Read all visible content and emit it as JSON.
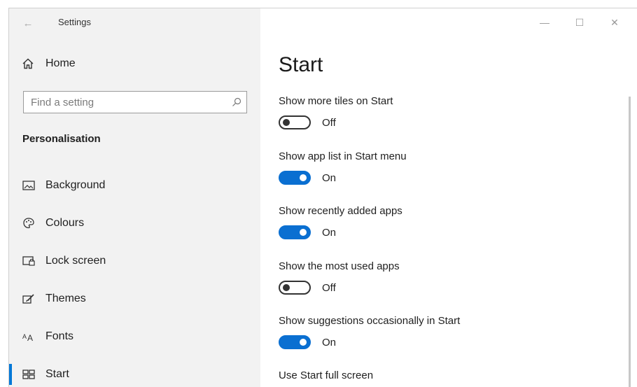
{
  "window": {
    "title": "Settings",
    "controls": {
      "minimize": "—",
      "maximize": "☐",
      "close": "✕"
    },
    "back_glyph": "←"
  },
  "sidebar": {
    "home_label": "Home",
    "search_placeholder": "Find a setting",
    "section_heading": "Personalisation",
    "items": [
      {
        "label": "Background",
        "icon": "picture-icon",
        "selected": false
      },
      {
        "label": "Colours",
        "icon": "palette-icon",
        "selected": false
      },
      {
        "label": "Lock screen",
        "icon": "lock-screen-icon",
        "selected": false
      },
      {
        "label": "Themes",
        "icon": "brush-icon",
        "selected": false
      },
      {
        "label": "Fonts",
        "icon": "font-icon",
        "selected": false
      },
      {
        "label": "Start",
        "icon": "start-grid-icon",
        "selected": true
      }
    ]
  },
  "main": {
    "title": "Start",
    "settings": [
      {
        "label": "Show more tiles on Start",
        "state": "Off",
        "on": false
      },
      {
        "label": "Show app list in Start menu",
        "state": "On",
        "on": true
      },
      {
        "label": "Show recently added apps",
        "state": "On",
        "on": true
      },
      {
        "label": "Show the most used apps",
        "state": "Off",
        "on": false
      },
      {
        "label": "Show suggestions occasionally in Start",
        "state": "On",
        "on": true
      },
      {
        "label": "Use Start full screen"
      }
    ]
  },
  "colors": {
    "accent": "#0078d7",
    "toggle_on": "#0a6fd1",
    "sidebar_bg": "#f2f2f2"
  }
}
